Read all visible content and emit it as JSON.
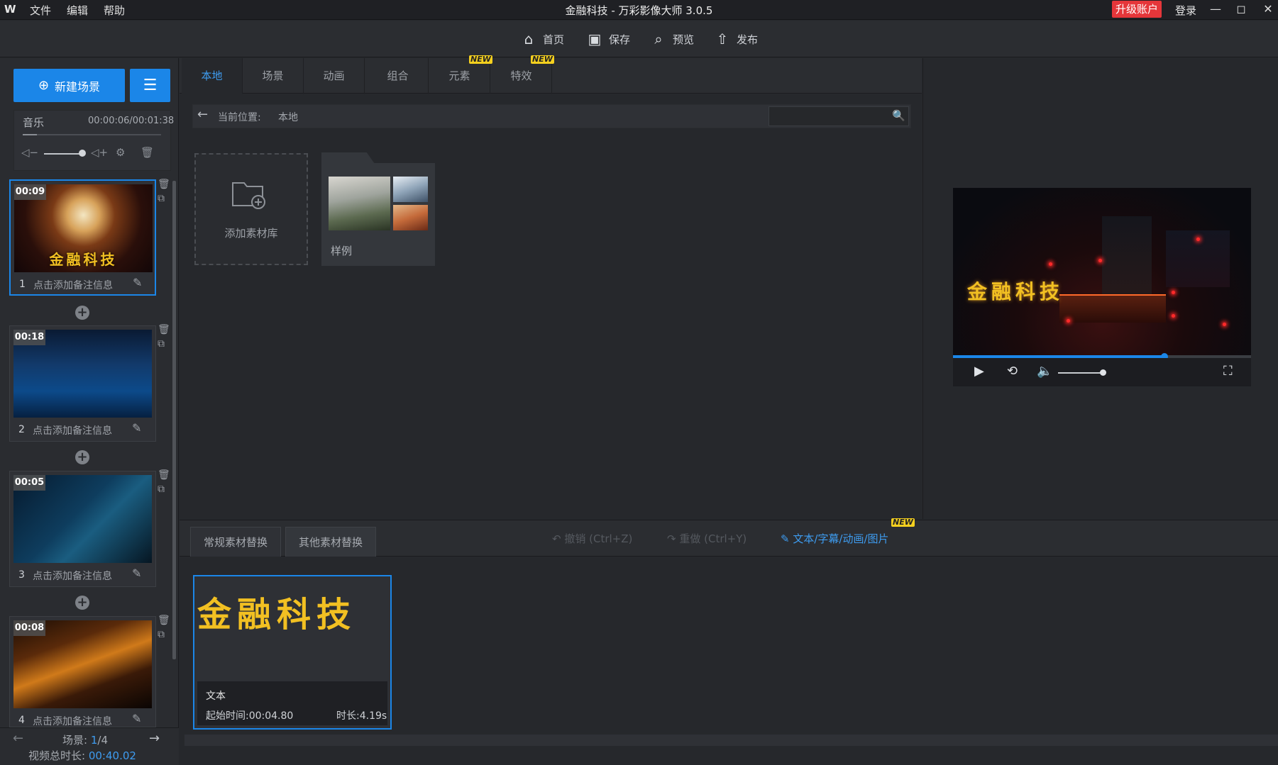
{
  "titlebar": {
    "logo": "W",
    "menu": [
      "文件",
      "编辑",
      "帮助"
    ],
    "title": "金融科技 - 万彩影像大师 3.0.5",
    "upgrade_label": "升级账户",
    "login_label": "登录"
  },
  "toolbar": {
    "home_label": "首页",
    "save_label": "保存",
    "preview_label": "预览",
    "publish_label": "发布"
  },
  "left_panel": {
    "new_scene_label": "新建场景",
    "music": {
      "label": "音乐",
      "time": "00:00:06/00:01:38"
    },
    "scenes": [
      {
        "number": "1",
        "duration": "00:09",
        "note": "点击添加备注信息",
        "thumb_text": "金融科技"
      },
      {
        "number": "2",
        "duration": "00:18",
        "note": "点击添加备注信息"
      },
      {
        "number": "3",
        "duration": "00:05",
        "note": "点击添加备注信息"
      },
      {
        "number": "4",
        "duration": "00:08",
        "note": "点击添加备注信息"
      }
    ],
    "scene_count_label": "场景:",
    "scene_current": "1",
    "scene_total": "/4",
    "total_duration_label": "视频总时长:",
    "total_duration": "00:40.02"
  },
  "library": {
    "tabs": [
      {
        "label": "本地",
        "active": true
      },
      {
        "label": "场景"
      },
      {
        "label": "动画"
      },
      {
        "label": "组合"
      },
      {
        "label": "元素",
        "badge": "NEW"
      },
      {
        "label": "特效",
        "badge": "NEW"
      }
    ],
    "path_label": "当前位置:",
    "path_value": "本地",
    "search_value": "",
    "add_library_label": "添加素材库",
    "folder_label": "样例"
  },
  "preview": {
    "video_title": "金融科技",
    "progress": 0.71
  },
  "editor": {
    "tabs": [
      "常规素材替换",
      "其他素材替换"
    ],
    "undo_label": "撤销 (Ctrl+Z)",
    "redo_label": "重做 (Ctrl+Y)",
    "text_sub_label": "文本/字幕/动画/图片",
    "text_sub_badge": "NEW",
    "card": {
      "title": "金融科技",
      "type": "文本",
      "start": "起始时间:00:04.80",
      "duration": "时长:4.19s"
    }
  },
  "colors": {
    "accent": "#1b86e8",
    "upgrade": "#e5363a",
    "gold_text": "#f2c022",
    "badge": "#f5d01f"
  }
}
